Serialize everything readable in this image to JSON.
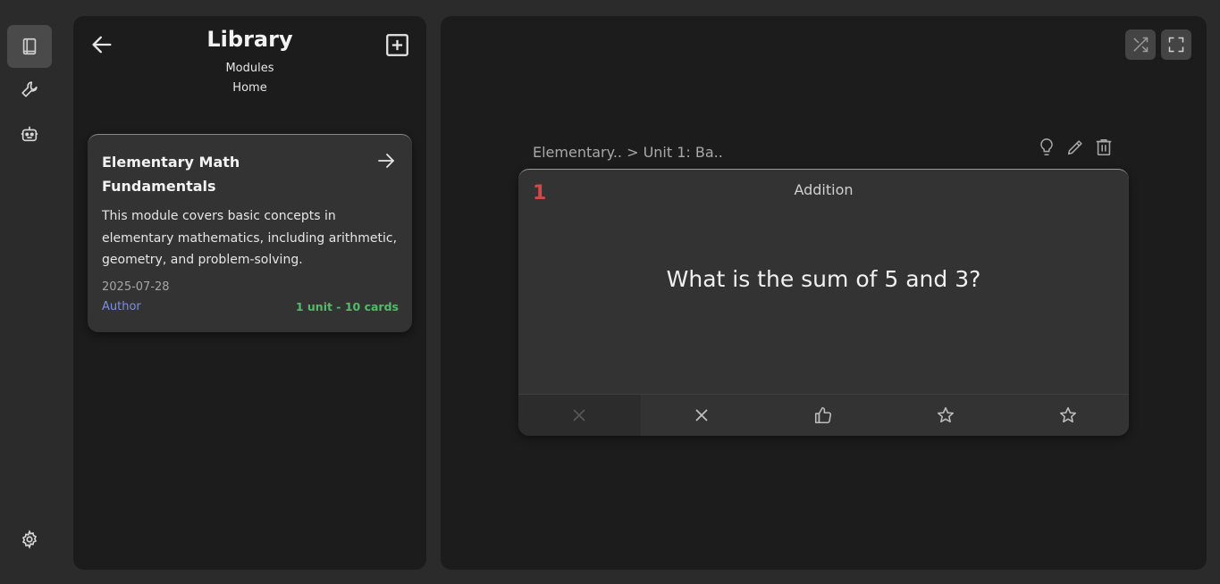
{
  "library": {
    "title": "Library",
    "subtitle_1": "Modules",
    "subtitle_2": "Home",
    "module": {
      "title": "Elementary Math Fundamentals",
      "description": "This module covers basic concepts in elementary mathematics, including arithmetic, geometry, and problem-solving.",
      "date": "2025-07-28",
      "author": "Author",
      "count": "1 unit - 10 cards"
    }
  },
  "main": {
    "breadcrumb": "Elementary.. > Unit 1: Ba..",
    "card": {
      "number": "1",
      "topic": "Addition",
      "question": "What is the sum of 5 and 3?"
    }
  },
  "colors": {
    "accent_author": "#7b8fe0",
    "count_green": "#57b86a",
    "card_number_red": "#d14a4a"
  },
  "icons": {
    "rail": [
      "book-icon",
      "wrench-icon",
      "robot-icon",
      "gear-icon"
    ],
    "toolbar": [
      "shuffle-icon",
      "fullscreen-icon"
    ],
    "card_actions": [
      "lightbulb-icon",
      "pencil-icon",
      "trash-icon"
    ],
    "ratings": [
      "x-icon",
      "x-icon",
      "thumbs-up-icon",
      "star-icon",
      "star-icon"
    ]
  }
}
